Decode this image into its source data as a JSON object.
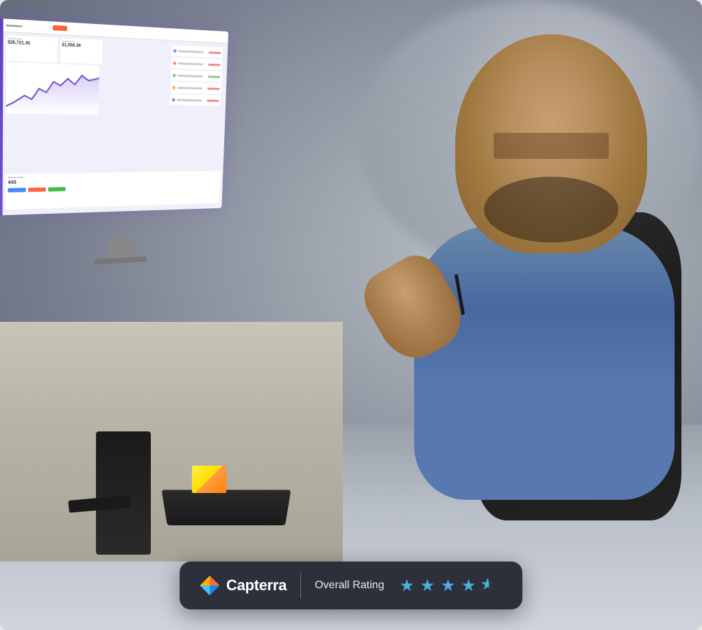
{
  "image": {
    "alt": "Man looking at computer dashboard in office/garage setting"
  },
  "rating_bar": {
    "logo_text": "Capterra",
    "overall_rating_label": "Overall Rating",
    "stars_count": 4.5,
    "star_color": "#4ab0e0",
    "stars": [
      {
        "filled": true,
        "label": "star-1"
      },
      {
        "filled": true,
        "label": "star-2"
      },
      {
        "filled": true,
        "label": "star-3"
      },
      {
        "filled": true,
        "label": "star-4"
      },
      {
        "filled": "half",
        "label": "star-5"
      }
    ]
  },
  "dashboard": {
    "title": "Dashboard",
    "revenue": "$26,721.45",
    "transactions": "$1,056.39",
    "leads": "443"
  }
}
